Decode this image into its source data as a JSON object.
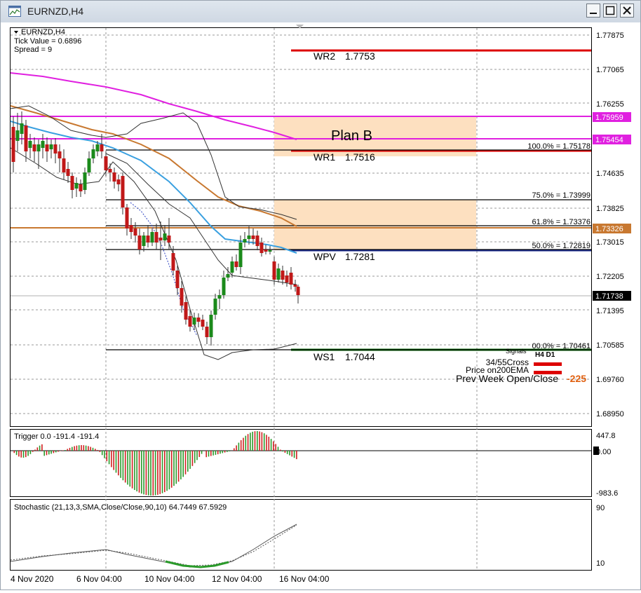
{
  "window": {
    "title": "EURNZD,H4"
  },
  "info": {
    "symbol": "EURNZD,H4",
    "tick_value": "Tick Value = 0.6896",
    "spread": "Spread = 9"
  },
  "plan_label": "Plan B",
  "price_levels": [
    {
      "label": "WR2",
      "value": "1.7753"
    },
    {
      "label": "WR1",
      "value": "1.7516"
    },
    {
      "label": "WPV",
      "value": "1.7281"
    },
    {
      "label": "WS1",
      "value": "1.7044"
    }
  ],
  "fib_levels": [
    "100.0% = 1.75178",
    "75.0% = 1.73999",
    "61.8% = 1.73376",
    "50.0% = 1.72819",
    "00.0% = 1.70461"
  ],
  "price_axis": [
    "1.77875",
    "1.77065",
    "1.76255",
    "1.74635",
    "1.73825",
    "1.73015",
    "1.72205",
    "1.71395",
    "1.70585",
    "1.69760",
    "1.68950"
  ],
  "price_tags": [
    {
      "value": "1.75959",
      "color": "#e020e0"
    },
    {
      "value": "1.75454",
      "color": "#e020e0"
    },
    {
      "value": "1.73326",
      "color": "#c87830"
    },
    {
      "value": "1.71738",
      "color": "#000000"
    }
  ],
  "signals": {
    "header": "Signals",
    "timeframes": "H4 D1",
    "rows": [
      "34/55Cross",
      "Price on200EMA"
    ],
    "prev_week": "Prev Week Open/Close",
    "prev_week_value": "-225"
  },
  "trigger": {
    "label": "Trigger 0.0 -191.4 -191.4",
    "axis_top": "447.8",
    "axis_zero": "0.00",
    "axis_bottom": "-983.6"
  },
  "stochastic": {
    "label": "Stochastic (21,13,3,SMA,Close/Close,90,10) 64.7449 67.5929",
    "axis_top": "90",
    "axis_bottom": "10"
  },
  "time_axis": [
    "4 Nov 2020",
    "6 Nov 04:00",
    "10 Nov 04:00",
    "12 Nov 04:00",
    "16 Nov 04:00"
  ],
  "colors": {
    "resistance": "#dd0000",
    "support": "#006400",
    "zone": "#fde0c0",
    "magenta": "#e020e0",
    "orange_ma": "#c87830",
    "blue_ma": "#3aa0e0"
  }
}
